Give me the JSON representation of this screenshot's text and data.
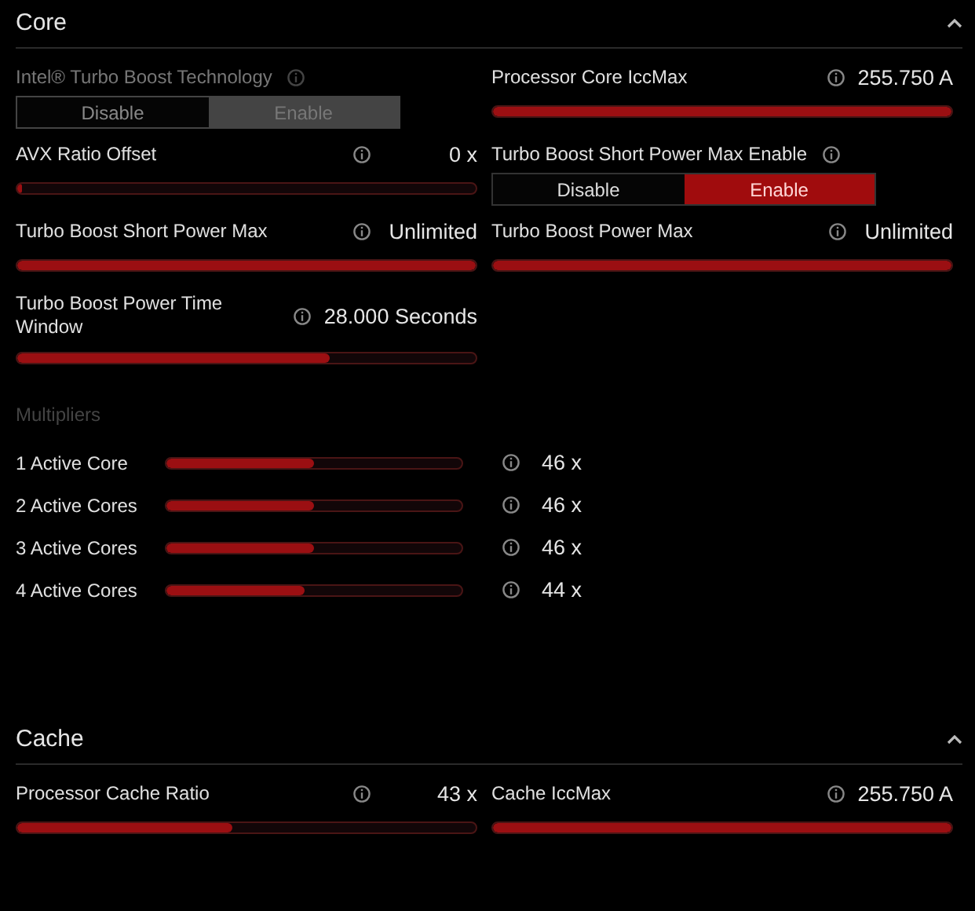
{
  "sections": [
    {
      "title": "Core",
      "expanded": true,
      "columns": [
        [
          {
            "kind": "toggle",
            "label": "Intel® Turbo Boost Technology",
            "disabled": true,
            "options": [
              {
                "label": "Disable",
                "selected": false
              },
              {
                "label": "Enable",
                "selected": true
              }
            ]
          },
          {
            "kind": "slider",
            "label": "AVX Ratio Offset",
            "value": "0 x",
            "level": 0
          },
          {
            "kind": "slider",
            "label": "Turbo Boost Short Power Max",
            "value": "Unlimited",
            "level": 1
          },
          {
            "kind": "slider",
            "label": "Turbo Boost Power Time Window",
            "value": "28.000 Seconds",
            "level": 0.68
          }
        ],
        [
          {
            "kind": "slider",
            "label": "Processor Core IccMax",
            "value": "255.750 A",
            "level": 1
          },
          {
            "kind": "toggle",
            "label": "Turbo Boost Short Power Max Enable",
            "disabled": false,
            "options": [
              {
                "label": "Disable",
                "selected": false
              },
              {
                "label": "Enable",
                "selected": true
              }
            ]
          },
          {
            "kind": "slider",
            "label": "Turbo Boost Power Max",
            "value": "Unlimited",
            "level": 1
          }
        ]
      ],
      "subsection": {
        "title": "Multipliers",
        "rows": [
          {
            "label": "1 Active Core",
            "value": "46 x",
            "level": 0.5
          },
          {
            "label": "2 Active Cores",
            "value": "46 x",
            "level": 0.5
          },
          {
            "label": "3 Active Cores",
            "value": "46 x",
            "level": 0.5
          },
          {
            "label": "4 Active Cores",
            "value": "44 x",
            "level": 0.47
          }
        ]
      }
    },
    {
      "title": "Cache",
      "expanded": true,
      "columns": [
        [
          {
            "kind": "slider",
            "label": "Processor Cache Ratio",
            "value": "43 x",
            "level": 0.47
          }
        ],
        [
          {
            "kind": "slider",
            "label": "Cache IccMax",
            "value": "255.750 A",
            "level": 1
          }
        ]
      ]
    }
  ]
}
